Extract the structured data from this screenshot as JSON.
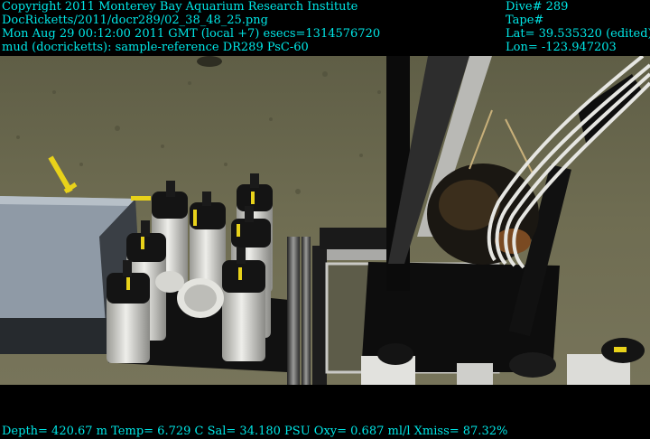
{
  "overlay": {
    "top_left": [
      "Copyright 2011 Monterey Bay Aquarium Research Institute",
      "DocRicketts/2011/docr289/02_38_48_25.png",
      "Mon Aug 29 00:12:00 2011 GMT (local +7)  esecs=1314576720",
      "mud (docricketts): sample-reference DR289 PsC-60"
    ],
    "top_right": [
      "Dive# 289",
      "Tape#",
      "Lat= 39.535320 (edited)",
      "Lon= -123.947203"
    ],
    "bottom": "Depth= 420.67 m  Temp= 6.729 C  Sal= 34.180 PSU  Oxy= 0.687 ml/l  Xmiss= 87.32%"
  },
  "colors": {
    "overlay_text": "#00e6e6",
    "seafloor": "#6f6d52",
    "frame_black": "#0b0b0b",
    "tube_white": "#d9d9d4",
    "handle_yellow": "#e8d21a"
  }
}
